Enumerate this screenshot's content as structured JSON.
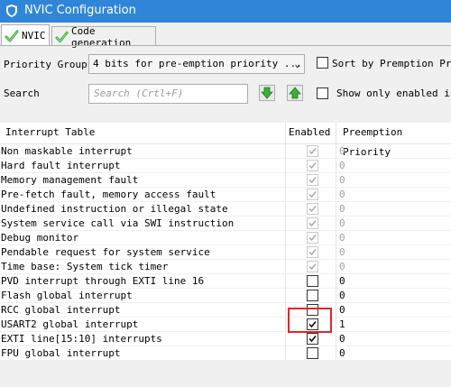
{
  "window": {
    "title": "NVIC Configuration"
  },
  "tabs": [
    {
      "label": "NVIC",
      "active": true
    },
    {
      "label": "Code generation",
      "active": false
    }
  ],
  "priority_group": {
    "label": "Priority Group",
    "value": "4 bits for pre-emption priority ...",
    "arrow": "⌄"
  },
  "sort_option": {
    "label": "Sort by Premption Prio",
    "checked": false
  },
  "search": {
    "label": "Search",
    "placeholder": "Search (Crtl+F)"
  },
  "show_enabled": {
    "label": "Show only enabled int",
    "checked": false
  },
  "table": {
    "headers": {
      "name": "Interrupt Table",
      "enabled": "Enabled",
      "priority": "Preemption Priority"
    },
    "rows": [
      {
        "name": "Non maskable interrupt",
        "enabled": true,
        "locked": true,
        "priority": "0"
      },
      {
        "name": "Hard fault interrupt",
        "enabled": true,
        "locked": true,
        "priority": "0"
      },
      {
        "name": "Memory management fault",
        "enabled": true,
        "locked": true,
        "priority": "0"
      },
      {
        "name": "Pre-fetch fault, memory access fault",
        "enabled": true,
        "locked": true,
        "priority": "0"
      },
      {
        "name": "Undefined instruction or illegal state",
        "enabled": true,
        "locked": true,
        "priority": "0"
      },
      {
        "name": "System service call via SWI instruction",
        "enabled": true,
        "locked": true,
        "priority": "0"
      },
      {
        "name": "Debug monitor",
        "enabled": true,
        "locked": true,
        "priority": "0"
      },
      {
        "name": "Pendable request for system service",
        "enabled": true,
        "locked": true,
        "priority": "0"
      },
      {
        "name": "Time base: System tick timer",
        "enabled": true,
        "locked": true,
        "priority": "0"
      },
      {
        "name": "PVD interrupt through EXTI line 16",
        "enabled": false,
        "locked": false,
        "priority": "0"
      },
      {
        "name": "Flash global interrupt",
        "enabled": false,
        "locked": false,
        "priority": "0"
      },
      {
        "name": "RCC global interrupt",
        "enabled": false,
        "locked": false,
        "priority": "0"
      },
      {
        "name": "USART2 global interrupt",
        "enabled": true,
        "locked": false,
        "priority": "1"
      },
      {
        "name": "EXTI line[15:10] interrupts",
        "enabled": true,
        "locked": false,
        "priority": "0"
      },
      {
        "name": "FPU global interrupt",
        "enabled": false,
        "locked": false,
        "priority": "0"
      }
    ]
  },
  "colors": {
    "titlebar": "#2f86d9",
    "highlight": "#e0262a",
    "tab_check": "#3aa83a",
    "arrow_button": "#38b03a"
  },
  "icons": {
    "window": "shield-icon",
    "tab": "green-check-icon",
    "down": "green-down-arrow-icon",
    "up": "green-up-arrow-icon"
  }
}
